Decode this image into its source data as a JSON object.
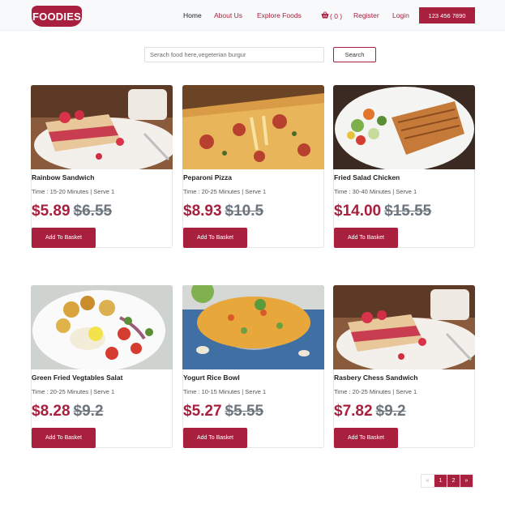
{
  "nav": {
    "logo": "FOODIES",
    "links": [
      "Home",
      "About Us",
      "Explore Foods"
    ],
    "cart": "( 0 )",
    "register": "Register",
    "login": "Login",
    "phone": "123 456 7890"
  },
  "search": {
    "placeholder": "Serach food here,vegeterian burgur",
    "button": "Search"
  },
  "products": [
    {
      "name": "Rainbow Sandwich",
      "meta": "Time : 15-20 Minutes | Serve 1",
      "price": "$5.89",
      "old_price": "$6.55",
      "button": "Add To Basket"
    },
    {
      "name": "Peparoni Pizza",
      "meta": "Time : 20-25 Minutes | Serve 1",
      "price": "$8.93",
      "old_price": "$10.5",
      "button": "Add To Basket"
    },
    {
      "name": "Fried Salad Chicken",
      "meta": "Time : 30-40 Minutes | Serve 1",
      "price": "$14.00",
      "old_price": "$15.55",
      "button": "Add To Basket"
    },
    {
      "name": "Green Fried Vegtables Salat",
      "meta": "Time : 20-25 Minutes | Serve 1",
      "price": "$8.28",
      "old_price": "$9.2",
      "button": "Add To Basket"
    },
    {
      "name": "Yogurt Rice Bowl",
      "meta": "Time : 10-15 Minutes | Serve 1",
      "price": "$5.27",
      "old_price": "$5.55",
      "button": "Add To Basket"
    },
    {
      "name": "Rasbery Chess Sandwich",
      "meta": "Time : 20-25 Minutes | Serve 1",
      "price": "$7.82",
      "old_price": "$9.2",
      "button": "Add To Basket"
    }
  ],
  "pagination": {
    "prev": "«",
    "pages": [
      "1",
      "2"
    ],
    "next": "»"
  },
  "colors": {
    "brand": "#a9203e",
    "strike": "#6c757d"
  },
  "icons": {
    "cart": "basket-icon"
  }
}
